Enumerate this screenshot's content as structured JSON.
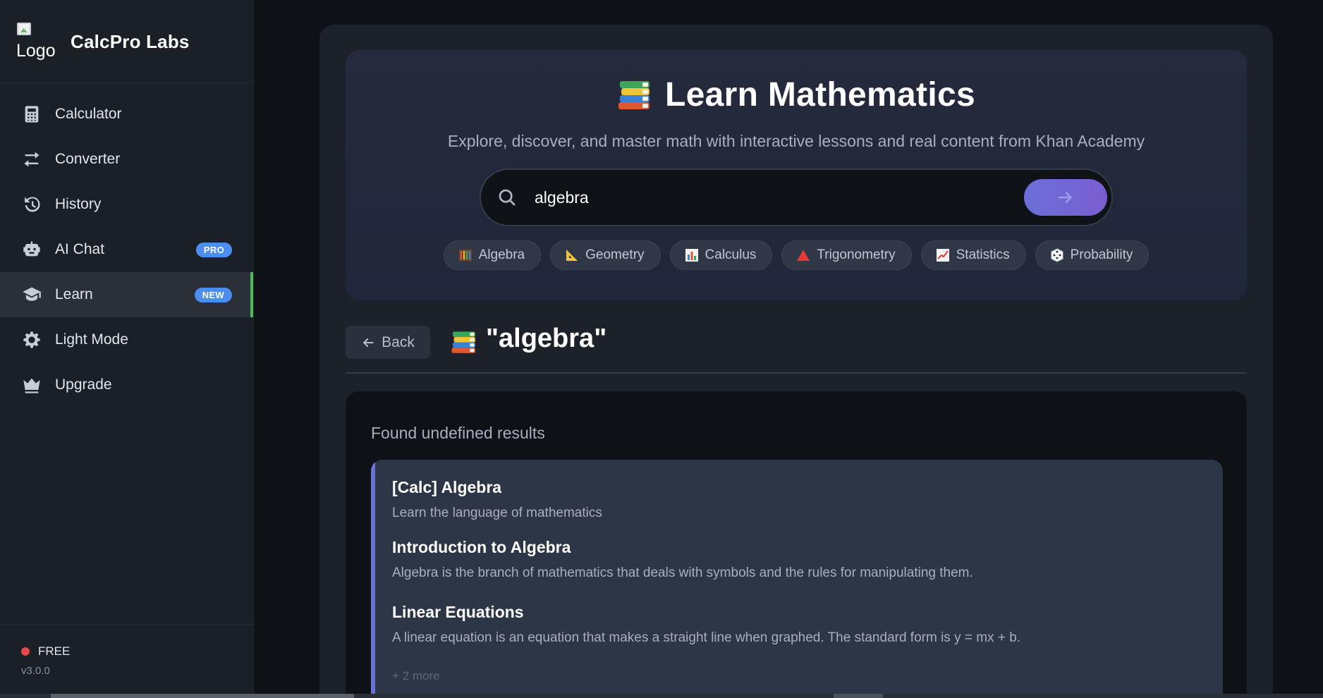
{
  "brand": {
    "logo_alt": "Logo",
    "name": "CalcPro Labs"
  },
  "sidebar": {
    "items": [
      {
        "label": "Calculator",
        "icon": "calculator-icon",
        "badge": ""
      },
      {
        "label": "Converter",
        "icon": "swap-arrows-icon",
        "badge": ""
      },
      {
        "label": "History",
        "icon": "history-icon",
        "badge": ""
      },
      {
        "label": "AI Chat",
        "icon": "robot-icon",
        "badge": "PRO"
      },
      {
        "label": "Learn",
        "icon": "graduation-cap-icon",
        "badge": "NEW",
        "active": true
      },
      {
        "label": "Light Mode",
        "icon": "gear-sun-icon",
        "badge": ""
      },
      {
        "label": "Upgrade",
        "icon": "crown-icon",
        "badge": ""
      }
    ],
    "footer": {
      "plan": "FREE",
      "version": "v3.0.0"
    }
  },
  "hero": {
    "title": "Learn Mathematics",
    "subtitle": "Explore, discover, and master math with interactive lessons and real content from Khan Academy",
    "search": {
      "value": "algebra",
      "placeholder": ""
    },
    "chips": [
      {
        "label": "Algebra",
        "icon": "abacus-icon"
      },
      {
        "label": "Geometry",
        "icon": "triangle-ruler-icon"
      },
      {
        "label": "Calculus",
        "icon": "bar-chart-icon"
      },
      {
        "label": "Trigonometry",
        "icon": "red-triangle-icon"
      },
      {
        "label": "Statistics",
        "icon": "trend-chart-icon"
      },
      {
        "label": "Probability",
        "icon": "dice-icon"
      }
    ]
  },
  "results": {
    "back_label": "Back",
    "query_heading": "\"algebra\"",
    "found_text": "Found undefined results",
    "card": {
      "title": "[Calc] Algebra",
      "subtitle": "Learn the language of mathematics",
      "items": [
        {
          "title": "Introduction to Algebra",
          "description": "Algebra is the branch of mathematics that deals with symbols and the rules for manipulating them."
        },
        {
          "title": "Linear Equations",
          "description": "A linear equation is an equation that makes a straight line when graphed. The standard form is y = mx + b."
        }
      ],
      "more": "+ 2 more"
    }
  },
  "colors": {
    "accent_active": "#4cb859",
    "badge": "#4e8df0",
    "search_button": "#6b6fd9",
    "card_border": "#6c73d8",
    "status_dot": "#e5484d"
  }
}
